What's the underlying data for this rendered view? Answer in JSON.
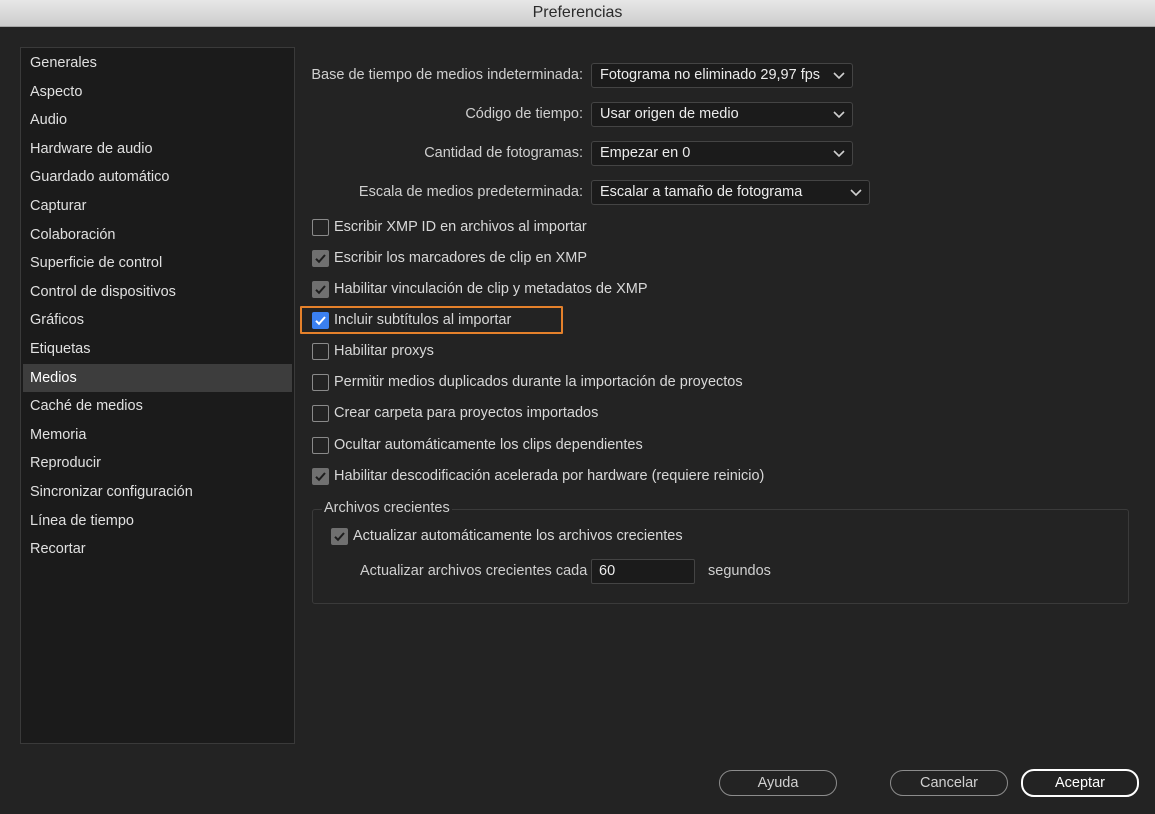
{
  "window": {
    "title": "Preferencias"
  },
  "sidebar": {
    "items": [
      {
        "label": "Generales"
      },
      {
        "label": "Aspecto"
      },
      {
        "label": "Audio"
      },
      {
        "label": "Hardware de audio"
      },
      {
        "label": "Guardado automático"
      },
      {
        "label": "Capturar"
      },
      {
        "label": "Colaboración"
      },
      {
        "label": "Superficie de control"
      },
      {
        "label": "Control de dispositivos"
      },
      {
        "label": "Gráficos"
      },
      {
        "label": "Etiquetas"
      },
      {
        "label": "Medios",
        "active": true
      },
      {
        "label": "Caché de medios"
      },
      {
        "label": "Memoria"
      },
      {
        "label": "Reproducir"
      },
      {
        "label": "Sincronizar configuración"
      },
      {
        "label": "Línea de tiempo"
      },
      {
        "label": "Recortar"
      }
    ]
  },
  "settings": {
    "timebase": {
      "label": "Base de tiempo de medios indeterminada:",
      "value": "Fotograma no eliminado 29,97  fps"
    },
    "timecode": {
      "label": "Código de tiempo:",
      "value": "Usar origen de medio"
    },
    "frame_count": {
      "label": "Cantidad de fotogramas:",
      "value": "Empezar en 0"
    },
    "scale": {
      "label": "Escala de medios predeterminada:",
      "value": "Escalar a tamaño de fotograma"
    }
  },
  "checkboxes": [
    {
      "label": "Escribir XMP ID en archivos al importar",
      "checked": false
    },
    {
      "label": "Escribir los marcadores de clip en XMP",
      "checked": true
    },
    {
      "label": "Habilitar vinculación de clip y metadatos de XMP",
      "checked": true
    },
    {
      "label": "Incluir subtítulos al importar",
      "checked": true
    },
    {
      "label": "Habilitar proxys",
      "checked": false
    },
    {
      "label": "Permitir medios duplicados durante la importación de proyectos",
      "checked": false
    },
    {
      "label": "Crear carpeta para proyectos importados",
      "checked": false
    },
    {
      "label": "Ocultar automáticamente los clips dependientes",
      "checked": false
    },
    {
      "label": "Habilitar descodificación acelerada por hardware (requiere reinicio)",
      "checked": true
    }
  ],
  "growing_files": {
    "title": "Archivos crecientes",
    "auto_update": {
      "label": "Actualizar automáticamente los archivos crecientes",
      "checked": true
    },
    "interval_label": "Actualizar archivos crecientes cada",
    "interval_value": "60",
    "interval_unit": "segundos"
  },
  "buttons": {
    "help": "Ayuda",
    "cancel": "Cancelar",
    "accept": "Aceptar"
  },
  "colors": {
    "highlight": "#e5812b",
    "checkbox_blue": "#3b80f0"
  }
}
